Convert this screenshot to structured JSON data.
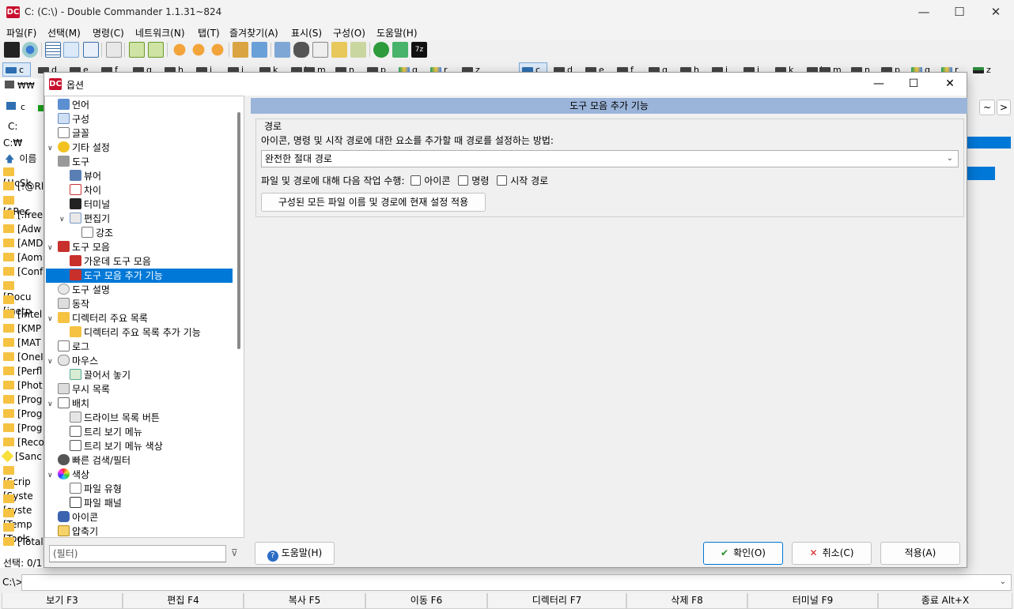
{
  "main_window": {
    "title": "C: (C:\\) - Double Commander 1.1.31~824",
    "logo": "DC",
    "minimize": "—",
    "maximize": "☐",
    "close": "✕"
  },
  "menubar": [
    "파일(F)",
    "선택(M)",
    "명령(C)",
    "네트워크(N)",
    "탭(T)",
    "즐겨찾기(A)",
    "표시(S)",
    "구성(O)",
    "도움말(H)"
  ],
  "drivebar": {
    "left": [
      "c",
      "d",
      "e",
      "f",
      "g",
      "h",
      "i",
      "j",
      "k",
      "l",
      "m",
      "n",
      "p",
      "q",
      "r",
      "z"
    ],
    "right": [
      "c",
      "d",
      "e",
      "f",
      "g",
      "h",
      "i",
      "j",
      "k",
      "l",
      "m",
      "n",
      "p",
      "q",
      "r",
      "z"
    ]
  },
  "left_panel": {
    "tab": "₩₩",
    "drive_btn": "c",
    "path_label": "C:",
    "current_path": "C:₩",
    "column_header": "이름",
    "files": [
      "[!!cSk",
      "[!@Rl",
      "[$Rec",
      "[.free",
      "[Adw",
      "[AMD",
      "[Aom",
      "[Conf",
      "[Docu",
      "[inetp",
      "[Intel",
      "[KMP",
      "[MAT",
      "[OneI",
      "[Perfl",
      "[Phot",
      "[Prog",
      "[Prog",
      "[Prog",
      "[Reco",
      "[Sanc",
      "[Scrip",
      "[Syste",
      "[syste",
      "[Temp",
      "[Tools",
      "[Total"
    ],
    "status": "선택: 0/1"
  },
  "right_panel": {
    "nav_back": "~",
    "nav_fwd": ">"
  },
  "command_line": {
    "prompt": "C:\\>",
    "value": ""
  },
  "function_keys": [
    "보기 F3",
    "편집 F4",
    "복사 F5",
    "이동 F6",
    "디렉터리 F7",
    "삭제 F8",
    "터미널 F9",
    "종료 Alt+X"
  ],
  "dialog": {
    "title": "옵션",
    "logo": "DC",
    "minimize": "—",
    "maximize": "☐",
    "close": "✕",
    "tree": [
      {
        "label": "언어",
        "level": 0,
        "icon": "language-icon"
      },
      {
        "label": "구성",
        "level": 0,
        "icon": "config-icon"
      },
      {
        "label": "글꼴",
        "level": 0,
        "icon": "font-icon"
      },
      {
        "label": "기타 설정",
        "level": 0,
        "icon": "misc-icon"
      },
      {
        "label": "도구",
        "level": 0,
        "icon": "tools-icon",
        "expanded": true
      },
      {
        "label": "뷰어",
        "level": 1,
        "icon": "viewer-icon"
      },
      {
        "label": "차이",
        "level": 1,
        "icon": "diff-icon"
      },
      {
        "label": "터미널",
        "level": 1,
        "icon": "terminal-icon"
      },
      {
        "label": "편집기",
        "level": 1,
        "icon": "editor-icon",
        "expanded": true
      },
      {
        "label": "강조",
        "level": 2,
        "icon": "highlight-icon"
      },
      {
        "label": "도구 모음",
        "level": 0,
        "icon": "toolbar-icon",
        "expanded": true
      },
      {
        "label": "가운데 도구 모음",
        "level": 1,
        "icon": "toolbar-middle-icon"
      },
      {
        "label": "도구 모음 추가 기능",
        "level": 1,
        "icon": "toolbar-extra-icon",
        "selected": true
      },
      {
        "label": "도구 설명",
        "level": 0,
        "icon": "tooltip-icon"
      },
      {
        "label": "동작",
        "level": 0,
        "icon": "behavior-icon"
      },
      {
        "label": "디렉터리 주요 목록",
        "level": 0,
        "icon": "hotlist-icon",
        "expanded": true
      },
      {
        "label": "디렉터리 주요 목록 추가 기능",
        "level": 1,
        "icon": "hotlist-extra-icon"
      },
      {
        "label": "로그",
        "level": 0,
        "icon": "log-icon"
      },
      {
        "label": "마우스",
        "level": 0,
        "icon": "mouse-icon",
        "expanded": true
      },
      {
        "label": "끌어서 놓기",
        "level": 1,
        "icon": "drag-drop-icon"
      },
      {
        "label": "무시 목록",
        "level": 0,
        "icon": "ignore-list-icon"
      },
      {
        "label": "배치",
        "level": 0,
        "icon": "layout-icon",
        "expanded": true
      },
      {
        "label": "드라이브 목록 버튼",
        "level": 1,
        "icon": "drive-list-icon"
      },
      {
        "label": "트리 보기 메뉴",
        "level": 1,
        "icon": "tree-menu-icon"
      },
      {
        "label": "트리 보기 메뉴 색상",
        "level": 1,
        "icon": "tree-menu-color-icon"
      },
      {
        "label": "빠른 검색/필터",
        "level": 0,
        "icon": "quick-search-icon"
      },
      {
        "label": "색상",
        "level": 0,
        "icon": "colors-icon",
        "expanded": true
      },
      {
        "label": "파일 유형",
        "level": 1,
        "icon": "file-types-icon"
      },
      {
        "label": "파일 패널",
        "level": 1,
        "icon": "file-panels-icon"
      },
      {
        "label": "아이콘",
        "level": 0,
        "icon": "icons-icon"
      },
      {
        "label": "압축기",
        "level": 0,
        "icon": "archiver-icon"
      }
    ],
    "panel_title": "도구 모음 추가 기능",
    "group_label": "경로",
    "path_method_label": "아이콘, 명령 및 시작 경로에 대한 요소를 추가할 때 경로를 설정하는 방법:",
    "path_method_value": "완전한 절대 경로",
    "action_label": "파일 및 경로에 대해 다음 작업 수행:",
    "checkboxes": [
      {
        "label": "아이콘",
        "checked": false
      },
      {
        "label": "명령",
        "checked": false
      },
      {
        "label": "시작 경로",
        "checked": false
      }
    ],
    "apply_all_button": "구성된 모든 파일 이름 및 경로에 현재 설정 적용",
    "filter_placeholder": "(필터)",
    "help_button": "도움말(H)",
    "ok_button": "확인(O)",
    "cancel_button": "취소(C)",
    "apply_button": "적용(A)"
  },
  "colors": {
    "selection": "#0078d7",
    "panel_header": "#9bb4d9",
    "folder": "#f5c242",
    "brand": "#c8102e"
  }
}
